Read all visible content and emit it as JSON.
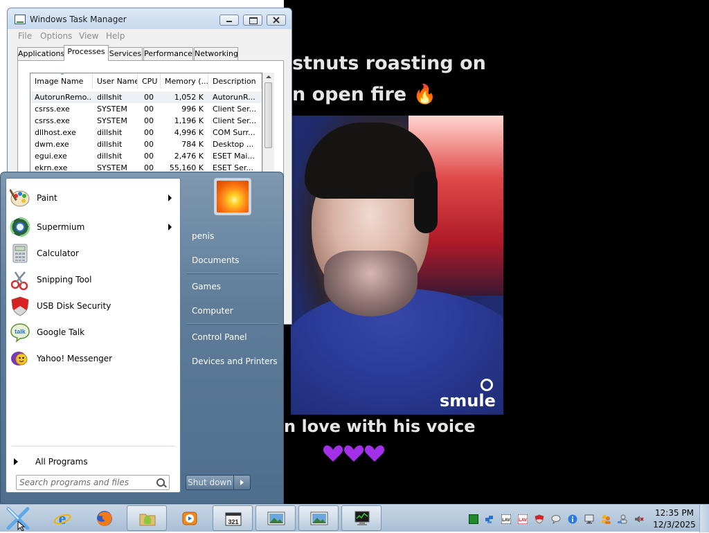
{
  "video": {
    "line1": "stnuts roasting on",
    "line2": "n open fire 🔥",
    "line3": "n love with his voice",
    "brand": "smule",
    "hearts": [
      "purple-heart",
      "purple-heart",
      "purple-heart"
    ],
    "colors": {
      "heart": "#a230e8",
      "text": "#e6e6e6"
    }
  },
  "task_manager": {
    "title": "Windows Task Manager",
    "menu": [
      "File",
      "Options",
      "View",
      "Help"
    ],
    "tabs": [
      "Applications",
      "Processes",
      "Services",
      "Performance",
      "Networking"
    ],
    "active_tab": "Processes",
    "columns": [
      "Image Name",
      "User Name",
      "CPU",
      "Memory (...",
      "Description"
    ],
    "rows": [
      {
        "image": "AutorunRemo...",
        "user": "dillshit",
        "cpu": "00",
        "memory": "1,052 K",
        "desc": "AutorunR..."
      },
      {
        "image": "csrss.exe",
        "user": "SYSTEM",
        "cpu": "00",
        "memory": "996 K",
        "desc": "Client Ser..."
      },
      {
        "image": "csrss.exe",
        "user": "SYSTEM",
        "cpu": "00",
        "memory": "1,196 K",
        "desc": "Client Ser..."
      },
      {
        "image": "dllhost.exe",
        "user": "dillshit",
        "cpu": "00",
        "memory": "4,996 K",
        "desc": "COM Surr..."
      },
      {
        "image": "dwm.exe",
        "user": "dillshit",
        "cpu": "00",
        "memory": "784 K",
        "desc": "Desktop ..."
      },
      {
        "image": "egui.exe",
        "user": "dillshit",
        "cpu": "00",
        "memory": "2,476 K",
        "desc": "ESET Mai..."
      },
      {
        "image": "ekrn.exe",
        "user": "SYSTEM",
        "cpu": "00",
        "memory": "55,160 K",
        "desc": "ESET Ser..."
      }
    ]
  },
  "start_menu": {
    "programs": [
      {
        "label": "Paint",
        "icon": "paint-icon",
        "submenu": true
      },
      {
        "label": "Supermium",
        "icon": "supermium-icon",
        "submenu": true
      },
      {
        "label": "Calculator",
        "icon": "calculator-icon",
        "submenu": false
      },
      {
        "label": "Snipping Tool",
        "icon": "scissors-icon",
        "submenu": false
      },
      {
        "label": "USB Disk Security",
        "icon": "shield-icon",
        "submenu": false
      },
      {
        "label": "Google Talk",
        "icon": "talk-bubble-icon",
        "submenu": false
      },
      {
        "label": "Yahoo! Messenger",
        "icon": "yahoo-messenger-icon",
        "submenu": false
      }
    ],
    "all_programs": "All Programs",
    "search_placeholder": "Search programs and files",
    "right_items": [
      "penis",
      "Documents",
      "Games",
      "Computer",
      "Control Panel",
      "Devices and Printers"
    ],
    "shutdown": "Shut down"
  },
  "taskbar": {
    "buttons": [
      "start-orb-icon",
      "internet-explorer-icon",
      "firefox-icon",
      "android-folder-icon",
      "media-player-icon",
      "media-player-classic-icon",
      "picture-viewer-icon",
      "picture-viewer-icon",
      "task-manager-icon"
    ],
    "tray_icons": [
      "green-square-icon",
      "network-icon",
      "lav-audio-icon",
      "lav-video-icon",
      "shield-icon",
      "chat-bubble-icon",
      "info-icon",
      "monitor-icon",
      "people-icon",
      "network-users-icon",
      "volume-muted-icon"
    ],
    "time": "12:35 PM",
    "date": "12/3/2025"
  }
}
